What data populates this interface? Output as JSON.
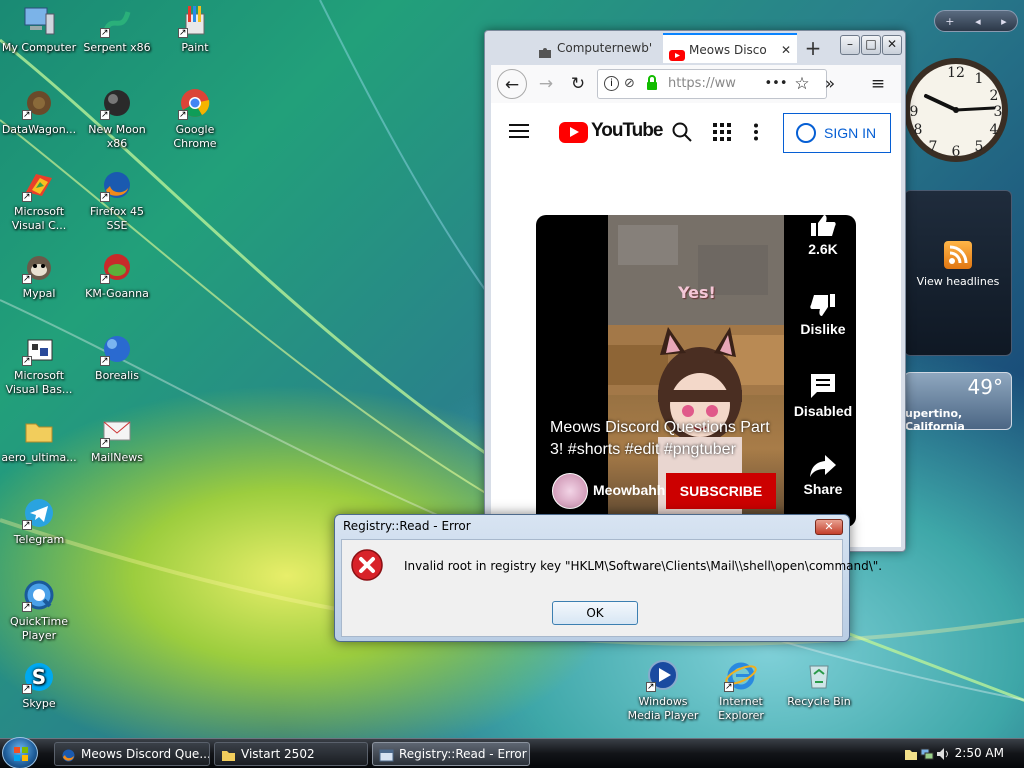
{
  "desktop": {
    "icons": [
      {
        "label": "My Computer"
      },
      {
        "label": "Serpent x86"
      },
      {
        "label": "Paint"
      },
      {
        "label": "DataWagon..."
      },
      {
        "label": "New Moon x86"
      },
      {
        "label": "Google Chrome"
      },
      {
        "label": "Microsoft Visual C..."
      },
      {
        "label": "Firefox 45 SSE"
      },
      {
        "label": "Mypal"
      },
      {
        "label": "KM-Goanna"
      },
      {
        "label": "Microsoft Visual Bas..."
      },
      {
        "label": "Borealis"
      },
      {
        "label": "aero_ultima..."
      },
      {
        "label": "MailNews"
      },
      {
        "label": "Telegram"
      },
      {
        "label": "QuickTime Player"
      },
      {
        "label": "Skype"
      },
      {
        "label": "Windows Media Player"
      },
      {
        "label": "Internet Explorer"
      },
      {
        "label": "Recycle Bin"
      }
    ]
  },
  "sidebar": {
    "toolbar_plus": "+",
    "toolbar_prev": "◂",
    "toolbar_next": "▸",
    "clock_icon": "analog-clock",
    "rss_label": "View headlines",
    "weather_temp": "49°",
    "weather_city": "upertino, California"
  },
  "browser": {
    "tabs": [
      {
        "title": "Computernewb'",
        "icon": "puzzle-icon"
      },
      {
        "title": "Meows Disco",
        "icon": "youtube-icon",
        "close": "✕"
      }
    ],
    "new_tab": "+",
    "window_buttons": {
      "minimize": "–",
      "maximize": "□",
      "close": "✕"
    },
    "url": "https://ww",
    "more": "•••",
    "star": "☆",
    "overflow": "»",
    "menu": "≡"
  },
  "youtube": {
    "logo_text": "YouTube",
    "sign_in": "SIGN IN",
    "video_overlay": "Yes!",
    "title": "Meows Discord Questions Part 3! #shorts #edit #pngtuber",
    "channel": "Meowbahh",
    "subscribe": "SUBSCRIBE",
    "likes": "2.6K",
    "dislike": "Dislike",
    "comments": "Disabled",
    "share": "Share"
  },
  "dialog": {
    "title": "Registry::Read - Error",
    "message": "Invalid root in registry key \"HKLM\\Software\\Clients\\Mail\\\\shell\\open\\command\\\".",
    "ok": "OK",
    "close": "✕"
  },
  "taskbar": {
    "tasks": [
      {
        "label": "Meows Discord Que..."
      },
      {
        "label": "Vistart 2502"
      },
      {
        "label": "Registry::Read - Error"
      }
    ],
    "time": "2:50 AM"
  }
}
